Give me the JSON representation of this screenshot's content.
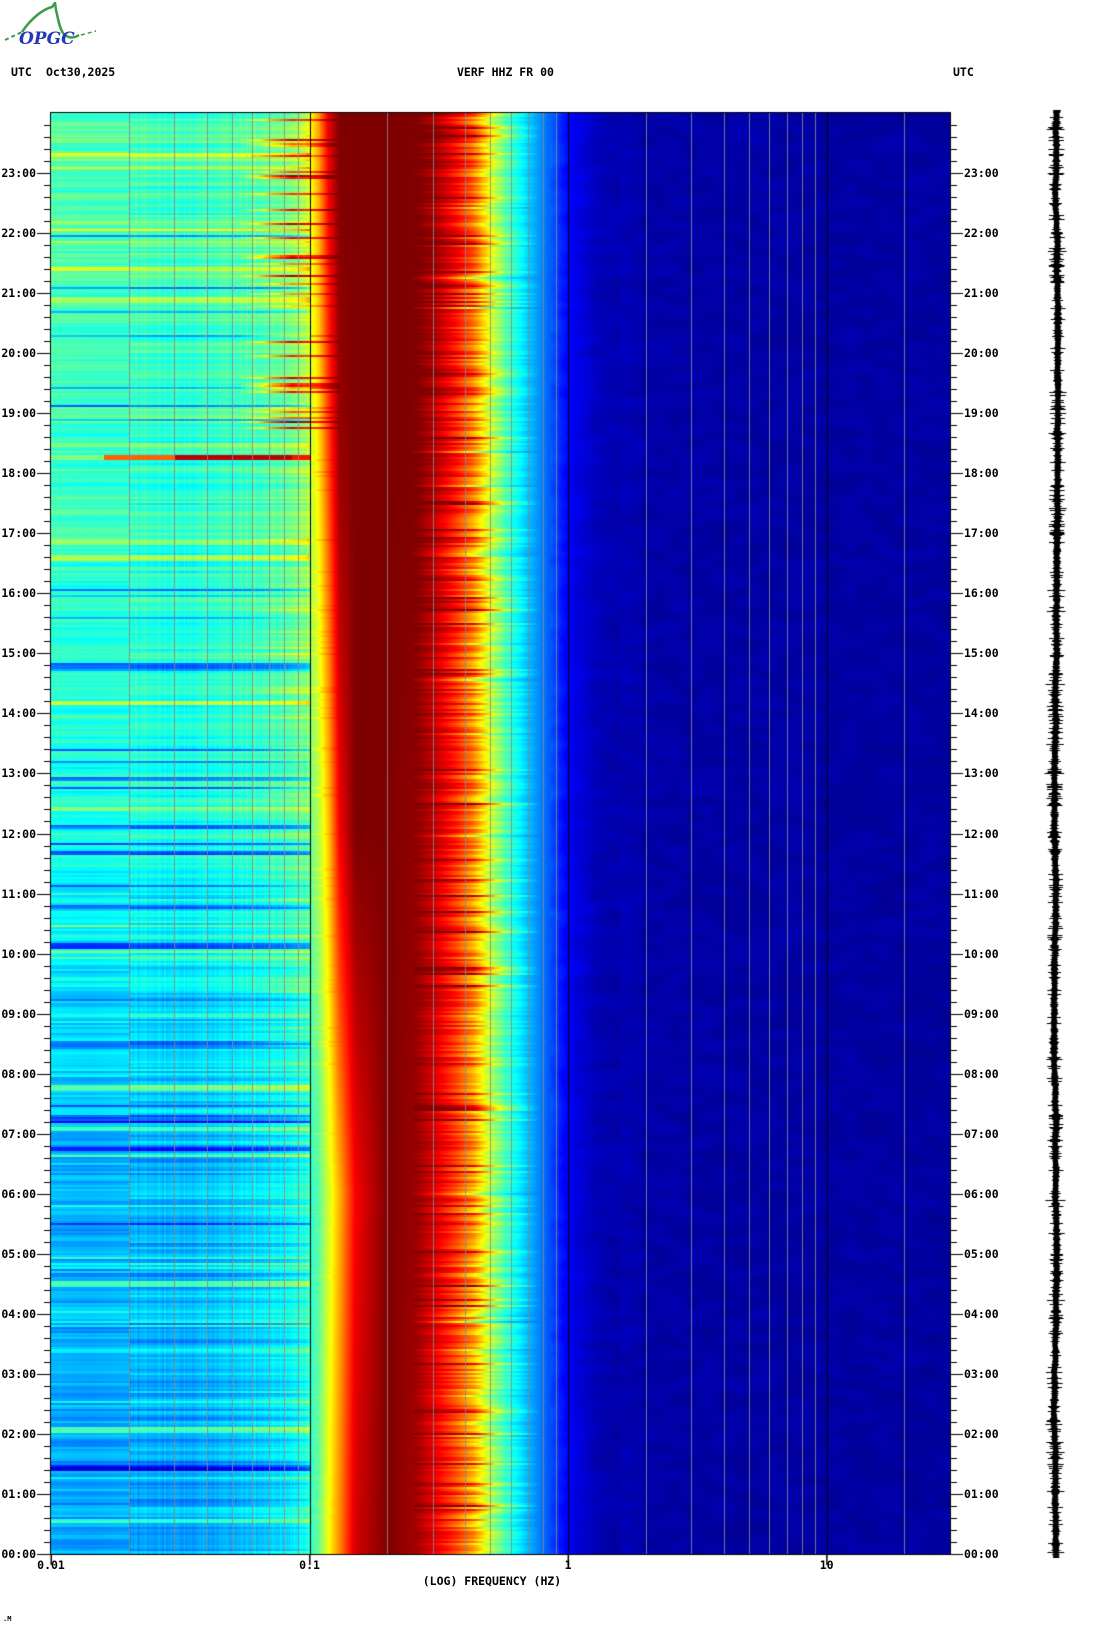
{
  "page": {
    "background": "#ffffff"
  },
  "logo": {
    "text": "OPGC",
    "line_color": "#3d9a4d",
    "text_color": "#2437b8"
  },
  "header": {
    "utc_left": "UTC",
    "date": "Oct30,2025",
    "title": "VERF HHZ FR 00",
    "utc_right": "UTC",
    "text_color": "#000000"
  },
  "footer": {
    "corner_mark": ".M"
  },
  "waveform": {
    "name": "helicorder-trace",
    "color": "#000000",
    "side": "right"
  },
  "chart_data": {
    "type": "heatmap",
    "subtype": "seismic spectrogram, 24-hour",
    "title": "VERF HHZ FR 00",
    "station": "VERF",
    "channel": "HHZ",
    "network": "FR",
    "location": "00",
    "date": "Oct30,2025",
    "timezone": "UTC",
    "xlabel": "(LOG) FREQUENCY (HZ)",
    "x_scale": "log",
    "x_range_hz": [
      0.01,
      30
    ],
    "x_ticks": [
      {
        "hz": 0.01,
        "label": "0.01"
      },
      {
        "hz": 0.1,
        "label": "0.1"
      },
      {
        "hz": 1,
        "label": "1"
      },
      {
        "hz": 10,
        "label": "10"
      }
    ],
    "x_major_gridlines_hz": [
      0.1,
      1,
      10
    ],
    "x_minor_gridlines_hz": [
      0.02,
      0.03,
      0.04,
      0.05,
      0.06,
      0.07,
      0.08,
      0.09,
      0.2,
      0.3,
      0.4,
      0.5,
      0.6,
      0.7,
      0.8,
      0.9,
      2,
      3,
      4,
      5,
      6,
      7,
      8,
      9,
      20
    ],
    "y_axis": "time (UTC), 00:00 bottom to 24:00 top",
    "y_range_hours": [
      0,
      24
    ],
    "y_tick_labels": [
      "23:00",
      "22:00",
      "21:00",
      "20:00",
      "19:00",
      "18:00",
      "17:00",
      "16:00",
      "15:00",
      "14:00",
      "13:00",
      "12:00",
      "11:00",
      "10:00",
      "09:00",
      "08:00",
      "07:00",
      "06:00",
      "05:00",
      "04:00",
      "03:00",
      "02:00",
      "01:00",
      "00:00"
    ],
    "y_minor_ticks_per_hour": 5,
    "colormap": "jet",
    "colormap_stops": [
      "#000080",
      "#0000ff",
      "#00ffff",
      "#80ff80",
      "#ffff00",
      "#ff8000",
      "#ff0000",
      "#800000"
    ],
    "gridline_color": "#888888",
    "spectral_model": {
      "comment": "relative power 0..1 (jet scale) read from the image; keyframes over the day",
      "anchor_freqs_hz": [
        0.01,
        0.014,
        0.02,
        0.03,
        0.045,
        0.065,
        0.09,
        0.1,
        0.108,
        0.118,
        0.13,
        0.15,
        0.2,
        0.26,
        0.31,
        0.37,
        0.43,
        0.5,
        0.58,
        0.7,
        0.85,
        1.0,
        1.3,
        2.0,
        4.0,
        8.0,
        15.0,
        30.0
      ],
      "keyframes": [
        {
          "t_hours": 0,
          "v": [
            0.29,
            0.28,
            0.29,
            0.29,
            0.3,
            0.33,
            0.37,
            0.42,
            0.48,
            0.62,
            0.74,
            0.92,
            1.0,
            0.96,
            0.88,
            0.79,
            0.69,
            0.54,
            0.42,
            0.3,
            0.2,
            0.125,
            0.062,
            0.04,
            0.036,
            0.036,
            0.034,
            0.032
          ]
        },
        {
          "t_hours": 6,
          "v": [
            0.3,
            0.29,
            0.3,
            0.3,
            0.31,
            0.34,
            0.38,
            0.41,
            0.46,
            0.58,
            0.7,
            0.88,
            1.0,
            0.97,
            0.9,
            0.81,
            0.71,
            0.55,
            0.43,
            0.31,
            0.2,
            0.125,
            0.062,
            0.04,
            0.036,
            0.036,
            0.034,
            0.032
          ]
        },
        {
          "t_hours": 12,
          "v": [
            0.4,
            0.39,
            0.4,
            0.39,
            0.4,
            0.42,
            0.46,
            0.48,
            0.55,
            0.68,
            0.88,
            1.0,
            1.0,
            0.98,
            0.92,
            0.83,
            0.73,
            0.57,
            0.44,
            0.31,
            0.21,
            0.13,
            0.065,
            0.04,
            0.037,
            0.037,
            0.035,
            0.033
          ]
        },
        {
          "t_hours": 18,
          "v": [
            0.44,
            0.43,
            0.43,
            0.42,
            0.43,
            0.45,
            0.5,
            0.56,
            0.64,
            0.8,
            0.97,
            1.0,
            1.0,
            1.0,
            0.94,
            0.85,
            0.75,
            0.59,
            0.45,
            0.32,
            0.21,
            0.13,
            0.07,
            0.042,
            0.038,
            0.038,
            0.036,
            0.034
          ]
        },
        {
          "t_hours": 24,
          "v": [
            0.46,
            0.45,
            0.45,
            0.44,
            0.45,
            0.47,
            0.53,
            0.62,
            0.72,
            0.9,
            1.0,
            1.0,
            1.0,
            1.0,
            0.96,
            0.87,
            0.77,
            0.6,
            0.46,
            0.33,
            0.22,
            0.14,
            0.07,
            0.042,
            0.038,
            0.038,
            0.036,
            0.034
          ]
        }
      ]
    },
    "events": [
      {
        "time_utc": "18:15",
        "freq_range_hz": [
          0.02,
          0.11
        ],
        "intensity": "strong (red / dark red)",
        "description": "transient long-period burst appearing as a bright horizontal streak"
      }
    ],
    "features": [
      "saturated dark-red microseism band near 0.13-0.3 Hz all day, widest late in the day",
      "low-frequency background (0.01-0.1 Hz) cyan during late hours, deep blue during 00:00-07:00",
      "jagged red-orange-yellow right flank 0.3-0.5 Hz decaying to cyan near 0.5-0.7 Hz",
      "uniform deep navy background above ~1 Hz with faint darker mottling 1.5-7 Hz",
      "short yellow/orange streaks near 0.06-0.12 Hz during 19:00-24:00"
    ]
  }
}
